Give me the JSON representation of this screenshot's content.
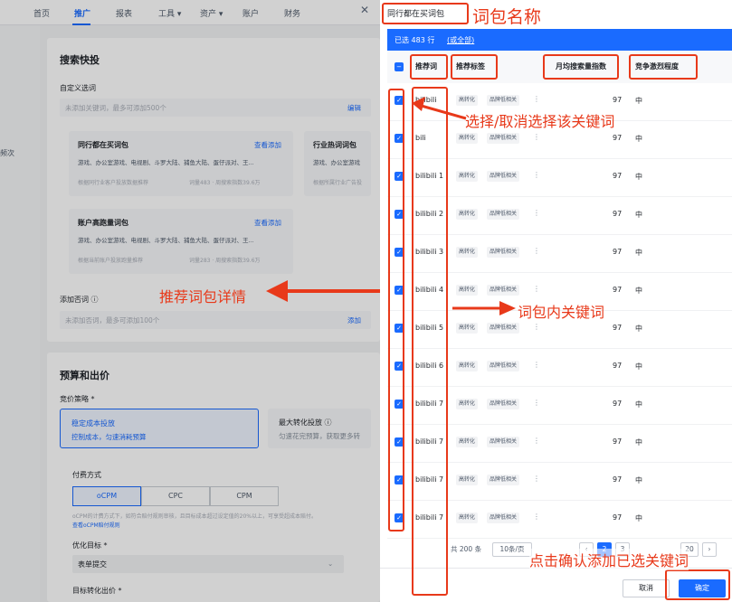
{
  "nav": {
    "items": [
      "首页",
      "推广",
      "报表",
      "工具 ▾",
      "资产 ▾",
      "账户",
      "财务"
    ]
  },
  "left_side": {
    "text": "频次"
  },
  "search": {
    "title": "搜索快投",
    "custom_label": "自定义选词",
    "custom_placeholder": "未添加关键词，最多可添加500个",
    "edit": "编辑",
    "packages": [
      {
        "title": "同行都在买词包",
        "link": "查看添加",
        "desc": "游戏、办公室游戏、电视剧、斗罗大陆、捕鱼大陆、蛋仔派对、王...",
        "meta": "根据同行业客户投放数据推荐",
        "stat": "词量483 · 周搜索指数39.6万"
      },
      {
        "title": "行业热词词包",
        "link": "",
        "desc": "游戏、办公室游戏",
        "meta": "根据所属行业广告投",
        "stat": ""
      },
      {
        "title": "账户高跑量词包",
        "link": "查看添加",
        "desc": "游戏、办公室游戏、电视剧、斗罗大陆、捕鱼大陆、蛋仔派对、王...",
        "meta": "根据当前账户投放跑量推荐",
        "stat": "词量283 · 周搜索指数39.6万"
      }
    ],
    "neg_label": "添加否词 ⓘ",
    "neg_placeholder": "未添加否词，最多可添加100个",
    "add": "添加"
  },
  "budget": {
    "title": "预算和出价",
    "strategy_label": "竞价策略 *",
    "opt1_title": "稳定成本投放",
    "opt1_desc": "控制成本，匀速消耗预算",
    "opt2_title": "最大转化投放 ⓘ",
    "opt2_desc": "匀速花完预算，获取更多转",
    "pay_label": "付费方式",
    "pay_modes": [
      "oCPM",
      "CPC",
      "CPM"
    ],
    "note1": "oCPM的计费方式下，如符合赔付规则审核，且目标成本超过设定值的20%以上，可享受超成本赔付。",
    "note2": "查看oCPM赔付规则",
    "goal_label": "优化目标 *",
    "goal_value": "表单提交",
    "bid_label": "目标转化出价 *"
  },
  "drawer": {
    "title": "同行都在买词包",
    "selected": "已选 483 行",
    "select_all": "(或全部)",
    "headers": [
      "推荐词",
      "推荐标签",
      "月均搜索量指数",
      "竞争激烈程度"
    ],
    "rows": [
      {
        "kw": "bilibili",
        "tag1": "高转化",
        "tag2": "品牌低相关",
        "idx": "97",
        "cmp": "中"
      },
      {
        "kw": "bili",
        "tag1": "高转化",
        "tag2": "品牌低相关",
        "idx": "97",
        "cmp": "中"
      },
      {
        "kw": "bilibili 1",
        "tag1": "高转化",
        "tag2": "品牌低相关",
        "idx": "97",
        "cmp": "中"
      },
      {
        "kw": "bilibili 2",
        "tag1": "高转化",
        "tag2": "品牌低相关",
        "idx": "97",
        "cmp": "中"
      },
      {
        "kw": "bilibili 3",
        "tag1": "高转化",
        "tag2": "品牌低相关",
        "idx": "97",
        "cmp": "中"
      },
      {
        "kw": "bilibili 4",
        "tag1": "高转化",
        "tag2": "品牌低相关",
        "idx": "97",
        "cmp": "中"
      },
      {
        "kw": "bilibili 5",
        "tag1": "高转化",
        "tag2": "品牌低相关",
        "idx": "97",
        "cmp": "中"
      },
      {
        "kw": "bilibili 6",
        "tag1": "高转化",
        "tag2": "品牌低相关",
        "idx": "97",
        "cmp": "中"
      },
      {
        "kw": "bilibili 7",
        "tag1": "高转化",
        "tag2": "品牌低相关",
        "idx": "97",
        "cmp": "中"
      },
      {
        "kw": "bilibili 7",
        "tag1": "高转化",
        "tag2": "品牌低相关",
        "idx": "97",
        "cmp": "中"
      },
      {
        "kw": "bilibili 7",
        "tag1": "高转化",
        "tag2": "品牌低相关",
        "idx": "97",
        "cmp": "中"
      },
      {
        "kw": "bilibili 7",
        "tag1": "高转化",
        "tag2": "品牌低相关",
        "idx": "97",
        "cmp": "中"
      }
    ],
    "total": "共 200 条",
    "page_size": "10条/页",
    "page_current": "2",
    "page_next": "3",
    "page_last": "20",
    "cancel": "取消",
    "confirm": "确定"
  },
  "annotations": {
    "name": "词包名称",
    "select": "选择/取消选择该关键词",
    "detail": "推荐词包详情",
    "inner": "词包内关键词",
    "confirm": "点击确认添加已选关键词"
  },
  "colors": {
    "accent": "#1a6bff",
    "annotation": "#e8391a"
  }
}
